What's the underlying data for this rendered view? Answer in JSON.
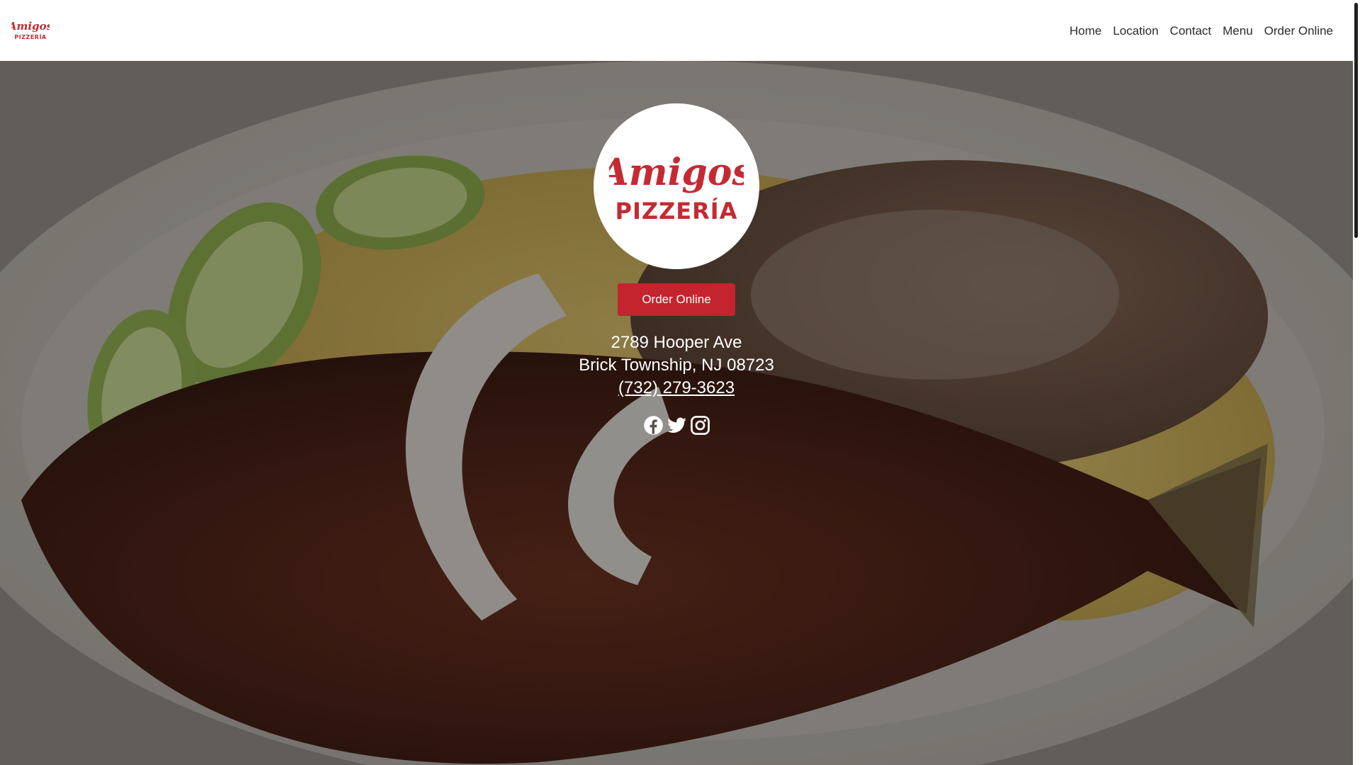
{
  "header": {
    "logo": {
      "word": "Amigos",
      "subword": "PIZZERÍA"
    },
    "nav": [
      {
        "label": "Home"
      },
      {
        "label": "Location"
      },
      {
        "label": "Contact"
      },
      {
        "label": "Menu"
      },
      {
        "label": "Order Online"
      }
    ]
  },
  "hero": {
    "logo": {
      "word": "Amigos",
      "subword": "PIZZERÍA"
    },
    "order_button_label": "Order Online",
    "address": {
      "street": "2789 Hooper Ave",
      "city_state_zip": "Brick Township, NJ 08723",
      "phone": "(732) 279-3623"
    },
    "social_icons": [
      "facebook-icon",
      "twitter-icon",
      "instagram-icon"
    ]
  },
  "colors": {
    "brand_red": "#c3242d",
    "logo_red": "#c52a32",
    "nav_text": "#2b2b2b",
    "overlay": "rgba(20,18,16,0.42)"
  }
}
